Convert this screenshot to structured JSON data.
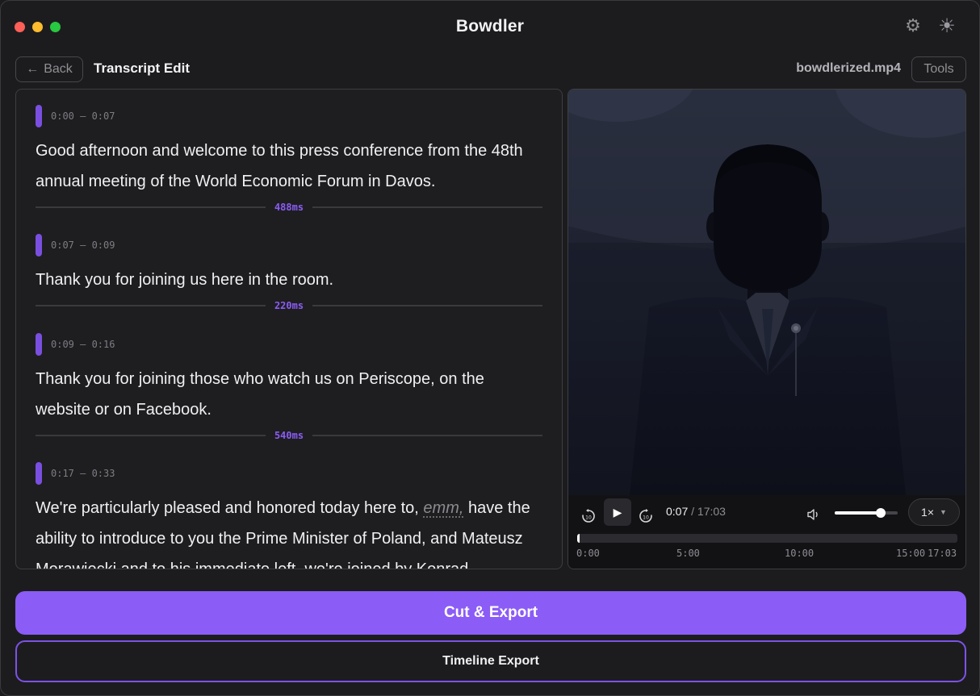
{
  "app": {
    "title": "Bowdler"
  },
  "toolbar": {
    "back_label": "Back",
    "page_title": "Transcript Edit",
    "filename": "bowdlerized.mp4",
    "tools_label": "Tools"
  },
  "icons": {
    "settings": "gear-icon",
    "theme": "sun-icon",
    "back": "arrow-left-icon",
    "skip_back": "rewind-10-icon",
    "play": "play-icon",
    "skip_forward": "forward-10-icon",
    "volume": "volume-icon",
    "dropdown": "chevron-down-icon"
  },
  "transcript": {
    "segments": [
      {
        "time": "0:00 – 0:07",
        "text": "Good afternoon and welcome to this press conference from the 48th annual meeting of the World Economic Forum in Davos."
      },
      {
        "time": "0:07 – 0:09",
        "text": "Thank you for joining us here in the room."
      },
      {
        "time": "0:09 – 0:16",
        "text": "Thank you for joining those who watch us on Periscope, on the website or on Facebook."
      },
      {
        "time": "0:17 – 0:33",
        "text_before": "We're particularly pleased and honored today here to, ",
        "filler": "emm,",
        "text_after": " have the ability to introduce to you the Prime Minister of Poland, and Mateusz Morawiecki and to his immediate left, we're joined by Konrad"
      }
    ],
    "gaps": [
      "488ms",
      "220ms",
      "540ms"
    ]
  },
  "player": {
    "current_time": "0:07",
    "separator": " / ",
    "duration": "17:03",
    "speed": "1×",
    "volume_fraction": 0.73,
    "progress_fraction": 0.0068,
    "ticks": [
      "0:00",
      "5:00",
      "10:00",
      "15:00",
      "17:03"
    ]
  },
  "actions": {
    "cut_export": "Cut & Export",
    "timeline_export": "Timeline Export"
  },
  "colors": {
    "accent": "#8b5cf6",
    "background": "#1c1c1e",
    "traffic_red": "#fe5f57",
    "traffic_yellow": "#febc2e",
    "traffic_green": "#28c840"
  }
}
